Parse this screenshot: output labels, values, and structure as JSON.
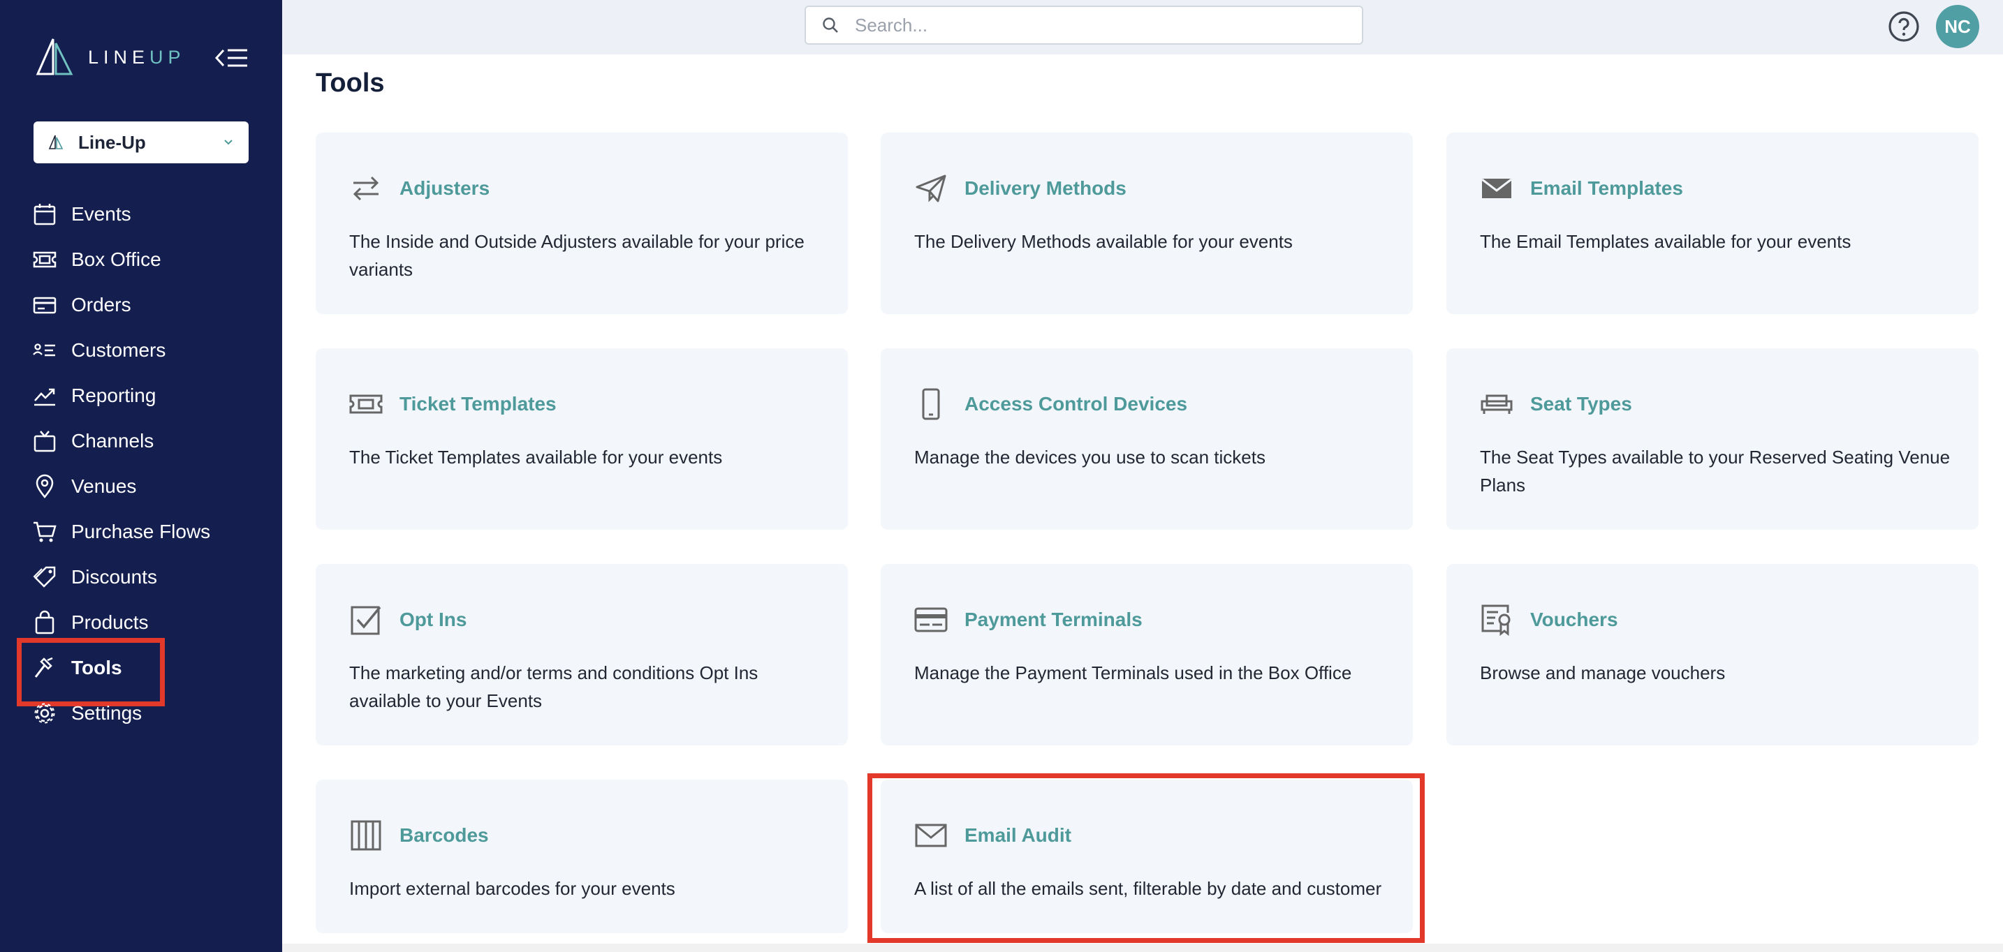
{
  "brand": {
    "line": "LINE",
    "up": "UP"
  },
  "org_select": {
    "label": "Line-Up"
  },
  "nav": [
    {
      "label": "Events",
      "icon": "calendar-icon"
    },
    {
      "label": "Box Office",
      "icon": "ticket-icon"
    },
    {
      "label": "Orders",
      "icon": "credit-card-icon"
    },
    {
      "label": "Customers",
      "icon": "contact-list-icon"
    },
    {
      "label": "Reporting",
      "icon": "trend-icon"
    },
    {
      "label": "Channels",
      "icon": "tv-icon"
    },
    {
      "label": "Venues",
      "icon": "map-pin-icon"
    },
    {
      "label": "Purchase Flows",
      "icon": "cart-icon"
    },
    {
      "label": "Discounts",
      "icon": "tag-icon"
    },
    {
      "label": "Products",
      "icon": "bag-icon"
    },
    {
      "label": "Tools",
      "icon": "hammer-icon",
      "active": true
    },
    {
      "label": "Settings",
      "icon": "gear-icon"
    }
  ],
  "search": {
    "placeholder": "Search..."
  },
  "user": {
    "initials": "NC"
  },
  "page": {
    "title": "Tools"
  },
  "tools": [
    {
      "title": "Adjusters",
      "description": "The Inside and Outside Adjusters available for your price variants",
      "icon": "swap-arrows-icon"
    },
    {
      "title": "Delivery Methods",
      "description": "The Delivery Methods available for your events",
      "icon": "paper-plane-icon"
    },
    {
      "title": "Email Templates",
      "description": "The Email Templates available for your events",
      "icon": "envelope-filled-icon"
    },
    {
      "title": "Ticket Templates",
      "description": "The Ticket Templates available for your events",
      "icon": "ticket-icon"
    },
    {
      "title": "Access Control Devices",
      "description": "Manage the devices you use to scan tickets",
      "icon": "mobile-device-icon"
    },
    {
      "title": "Seat Types",
      "description": "The Seat Types available to your Reserved Seating Venue Plans",
      "icon": "sofa-icon"
    },
    {
      "title": "Opt Ins",
      "description": "The marketing and/or terms and conditions Opt Ins available to your Events",
      "icon": "checkbox-icon"
    },
    {
      "title": "Payment Terminals",
      "description": "Manage the Payment Terminals used in the Box Office",
      "icon": "card-terminal-icon"
    },
    {
      "title": "Vouchers",
      "description": "Browse and manage vouchers",
      "icon": "voucher-icon"
    },
    {
      "title": "Barcodes",
      "description": "Import external barcodes for your events",
      "icon": "barcode-icon"
    },
    {
      "title": "Email Audit",
      "description": "A list of all the emails sent, filterable by date and customer",
      "icon": "envelope-outline-icon"
    }
  ],
  "colors": {
    "sidebar": "#141f4f",
    "accent": "#4e9a9b",
    "highlight": "#e3392a",
    "avatar": "#4f9fa4"
  }
}
